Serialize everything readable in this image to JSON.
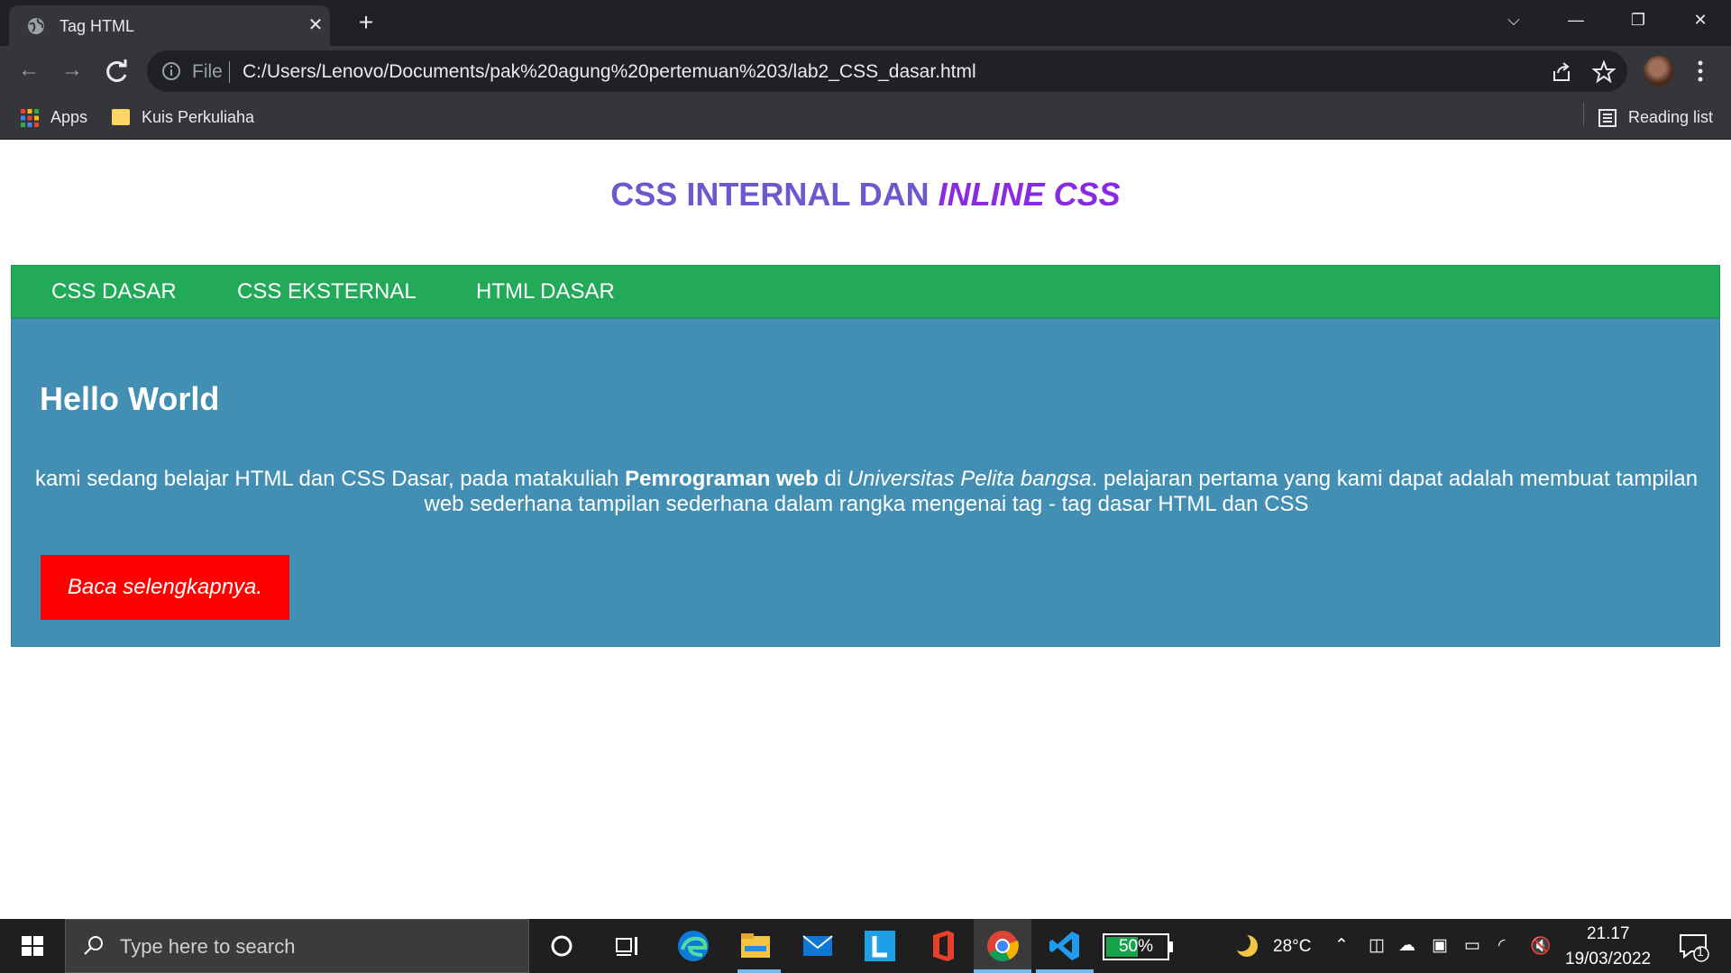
{
  "browser": {
    "tab_title": "Tag HTML",
    "address_prefix": "File",
    "url": "C:/Users/Lenovo/Documents/pak%20agung%20pertemuan%203/lab2_CSS_dasar.html",
    "bookmarks": [
      {
        "label": "Apps",
        "icon": "apps-grid-icon"
      },
      {
        "label": "Kuis Perkuliaha",
        "icon": "folder-icon"
      }
    ],
    "reading_list": "Reading list"
  },
  "page": {
    "title_plain": "CSS INTERNAL DAN ",
    "title_italic": "INLINE CSS",
    "nav": [
      "CSS DASAR",
      "CSS EKSTERNAL",
      "HTML DASAR"
    ],
    "heading": "Hello World",
    "paragraph": {
      "part1": "kami sedang belajar HTML dan CSS Dasar, pada matakuliah ",
      "bold": "Pemrograman web",
      "part2": " di ",
      "italic": "Universitas Pelita bangsa",
      "part3": ". pelajaran pertama yang kami dapat adalah membuat tampilan web sederhana tampilan sederhana dalam rangka mengenai tag - tag dasar HTML dan CSS"
    },
    "button": "Baca selengkapnya.",
    "colors": {
      "title": "#6a5acd",
      "title_italic": "#8a2be2",
      "navbar": "#22aa58",
      "content": "#428fb3",
      "button": "#ff0000"
    }
  },
  "taskbar": {
    "search_placeholder": "Type here to search",
    "battery": "50%",
    "battery_level": 0.5,
    "temperature": "28°C",
    "time": "21.17",
    "date": "19/03/2022",
    "notification_count": "1"
  }
}
